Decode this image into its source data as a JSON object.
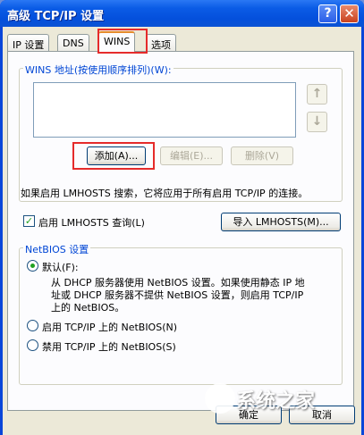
{
  "window": {
    "title": "高级 TCP/IP 设置",
    "help_glyph": "?",
    "close_glyph": "✕"
  },
  "tabs": [
    {
      "label": "IP 设置"
    },
    {
      "label": "DNS"
    },
    {
      "label": "WINS"
    },
    {
      "label": "选项"
    }
  ],
  "wins_group": {
    "label": "WINS 地址(按使用顺序排列)(W):",
    "up_glyph": "↑",
    "down_glyph": "↓",
    "add_label": "添加(A)...",
    "edit_label": "编辑(E)...",
    "delete_label": "删除(V)"
  },
  "lmhosts_note": "如果启用 LMHOSTS 搜索，它将应用于所有启用 TCP/IP 的连接。",
  "lmhosts": {
    "checkbox_label": "启用 LMHOSTS 查询(L)",
    "checked": true,
    "check_glyph": "✓",
    "import_label": "导入 LMHOSTS(M)..."
  },
  "netbios": {
    "group_label": "NetBIOS 设置",
    "default_label": "默认(F):",
    "default_desc_1": "从 DHCP 服务器使用 NetBIOS 设置。如果使用静态 IP 地",
    "default_desc_2": "址或 DHCP 服务器不提供 NetBIOS 设置，则启用 TCP/IP",
    "default_desc_3": "上的 NetBIOS。",
    "enable_label": "启用 TCP/IP 上的 NetBIOS(N)",
    "disable_label": "禁用 TCP/IP 上的 NetBIOS(S)",
    "selected": "default"
  },
  "footer": {
    "ok_label": "确定",
    "cancel_label": "取消"
  },
  "watermark": {
    "text": "系统之家"
  },
  "colors": {
    "highlight": "#e52b2b",
    "title_bar": "#0450dc",
    "group_label": "#0046d5"
  }
}
